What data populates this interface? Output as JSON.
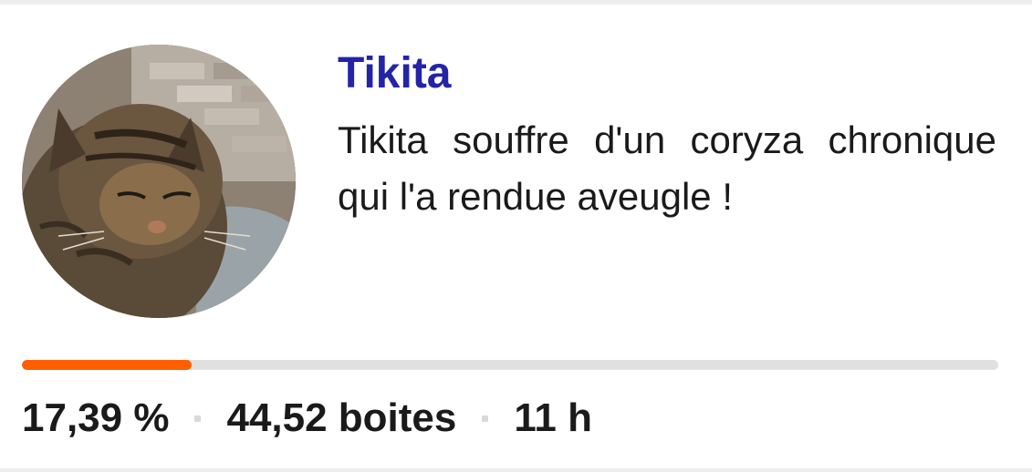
{
  "card": {
    "avatar_alt": "Tikita",
    "name": "Tikita",
    "description": "Tikita souffre d'un coryza chronique qui l'a rendue aveugle !"
  },
  "progress": {
    "fraction": 0.1739,
    "fill_color": "#ff5f00",
    "track_color": "#e0e0e0"
  },
  "stats": {
    "percent": "17,39 %",
    "boxes": "44,52 boites",
    "time": "11 h"
  },
  "colors": {
    "name": "#2424a8",
    "text": "#1a1a1a"
  }
}
